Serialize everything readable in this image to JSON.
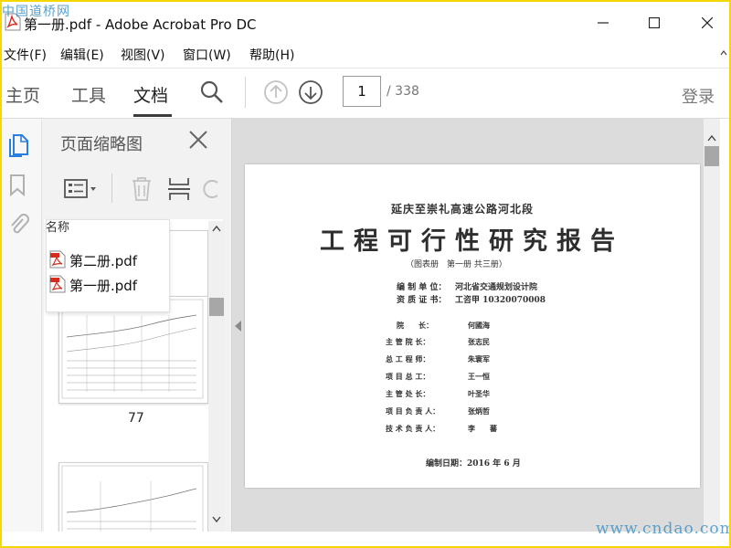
{
  "window": {
    "title": "第一册.pdf - Adobe Acrobat Pro DC"
  },
  "watermark": {
    "top_left": "中国道桥网",
    "bottom_right": "www.cndao.com"
  },
  "menu": [
    "文件(F)",
    "编辑(E)",
    "视图(V)",
    "窗口(W)",
    "帮助(H)"
  ],
  "tabs": [
    "主页",
    "工具",
    "文档"
  ],
  "toolbar": {
    "current_page": "1",
    "total_pages": "/ 338",
    "login_label": "登录"
  },
  "panel": {
    "title": "页面缩略图",
    "thumbnails": [
      {
        "label": "77"
      }
    ]
  },
  "file_popup": {
    "header": "名称",
    "files": [
      "第二册.pdf",
      "第一册.pdf"
    ]
  },
  "document": {
    "line1": "延庆至崇礼高速公路河北段",
    "line2": "工程可行性研究报告",
    "line3": "（图表册　第一册 共三册）",
    "org_label": "编 制 单 位：",
    "org_value": "河北省交通规划设计院",
    "cert_label": "资 质 证 书：",
    "cert_value": "工咨甲 10320070008",
    "roles": [
      {
        "role": "院　　长：",
        "name": "何國海"
      },
      {
        "role": "主 管 院 长：",
        "name": "张志民"
      },
      {
        "role": "总 工 程 师：",
        "name": "朱寰军"
      },
      {
        "role": "项 目 总 工：",
        "name": "王一恒"
      },
      {
        "role": "主 管 处 长：",
        "name": "叶圣华"
      },
      {
        "role": "项 目 负 责 人：",
        "name": "张炳哲"
      },
      {
        "role": "技 术 负 责 人：",
        "name": "李　　蕃"
      }
    ],
    "date": "编制日期：2016 年 6 月"
  },
  "colors": {
    "accent": "#3c3c3c",
    "watermark": "#3a8fc2",
    "pdf_red": "#d62b1f",
    "frame": "#f5d800"
  }
}
